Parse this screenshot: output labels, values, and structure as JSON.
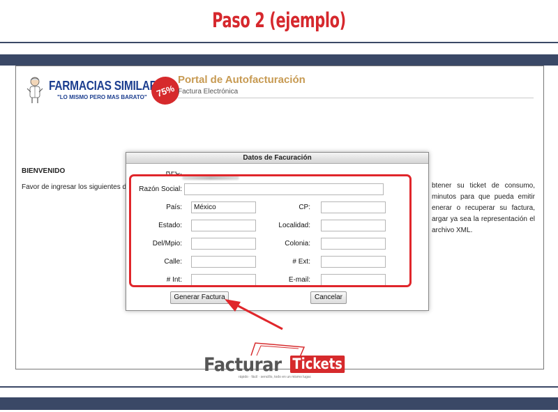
{
  "slide": {
    "title": "Paso 2 (ejemplo)"
  },
  "colors": {
    "accent_red": "#d6282d",
    "bar_navy": "#3a4866",
    "portal_gold": "#c79a52",
    "brand_blue": "#1c3e8f"
  },
  "portal": {
    "brand_name": "FARMACIAS SIMILARES",
    "brand_slogan": "\"LO MISMO PERO MAS BARATO\"",
    "brand_badge": "75%",
    "title": "Portal de Autofacturación",
    "subtitle": "Factura Electrónica",
    "welcome": "BIENVENIDO",
    "intro_left": "Favor de ingresar los siguientes d",
    "intro_right": "btener su ticket de consumo, minutos para que pueda emitir enerar o recuperar su factura, argar ya sea la representación el archivo XML."
  },
  "dialog": {
    "title": "Datos de Facuración",
    "rfc_label": "RFC:",
    "fields": {
      "razon_social": {
        "label": "Razón Social:",
        "value": ""
      },
      "pais": {
        "label": "País:",
        "value": "México"
      },
      "cp": {
        "label": "CP:",
        "value": ""
      },
      "estado": {
        "label": "Estado:",
        "value": ""
      },
      "localidad": {
        "label": "Localidad:",
        "value": ""
      },
      "del_mpio": {
        "label": "Del/Mpio:",
        "value": ""
      },
      "colonia": {
        "label": "Colonia:",
        "value": ""
      },
      "calle": {
        "label": "Calle:",
        "value": ""
      },
      "num_ext": {
        "label": "# Ext:",
        "value": ""
      },
      "num_int": {
        "label": "# Int:",
        "value": ""
      },
      "email": {
        "label": "E-mail:",
        "value": ""
      }
    },
    "buttons": {
      "generate": "Generar Factura",
      "cancel": "Cancelar"
    }
  },
  "watermark": {
    "word1": "Facturar",
    "word2": "Tickets",
    "tagline": "rápido · fácil · sencillo, todo en un mismo lugar."
  }
}
